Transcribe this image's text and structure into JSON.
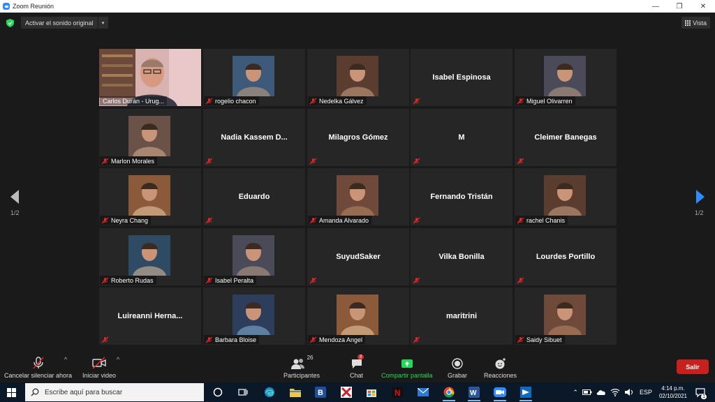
{
  "window": {
    "title": "Zoom Reunión",
    "minimize": "—",
    "restore": "❐",
    "close": "✕"
  },
  "topbar": {
    "original_sound_label": "Activar el sonido original",
    "caret": "▾",
    "view_label": "Vista"
  },
  "pager": {
    "left_page": "1/2",
    "right_page": "1/2"
  },
  "participants": [
    {
      "name": "Carlos Durán - Urug...",
      "type": "video",
      "active": true
    },
    {
      "name": "rogelio chacon",
      "type": "photo"
    },
    {
      "name": "Nedelka Gálvez",
      "type": "photo"
    },
    {
      "name": "Isabel Espinosa",
      "type": "text"
    },
    {
      "name": "Miguel Olivarren",
      "type": "photo"
    },
    {
      "name": "Marlon Morales",
      "type": "photo"
    },
    {
      "name": "Nadia Kassem D...",
      "type": "text"
    },
    {
      "name": "Milagros Gómez",
      "type": "text"
    },
    {
      "name": "M",
      "type": "text"
    },
    {
      "name": "Cleimer Banegas",
      "type": "text"
    },
    {
      "name": "Neyra Chang",
      "type": "photo"
    },
    {
      "name": "Eduardo",
      "type": "text"
    },
    {
      "name": "Amanda Alvarado",
      "type": "photo"
    },
    {
      "name": "Fernando Tristán",
      "type": "text"
    },
    {
      "name": "rachel Chanis",
      "type": "photo"
    },
    {
      "name": "Roberto Rudas",
      "type": "photo"
    },
    {
      "name": "Isabel Peralta",
      "type": "photo"
    },
    {
      "name": "SuyudSaker",
      "type": "text"
    },
    {
      "name": "Vilka Bonilla",
      "type": "text"
    },
    {
      "name": "Lourdes Portillo",
      "type": "text"
    },
    {
      "name": "Luireanni  Herna...",
      "type": "text"
    },
    {
      "name": "Barbara Bloise",
      "type": "photo"
    },
    {
      "name": "Mendoza Angel",
      "type": "photo"
    },
    {
      "name": "maritrini",
      "type": "text"
    },
    {
      "name": "Saidy Sibuet",
      "type": "photo"
    }
  ],
  "toolbar": {
    "mute_label": "Cancelar silenciar ahora",
    "video_label": "Iniciar video",
    "participants_label": "Participantes",
    "participants_count": "26",
    "chat_label": "Chat",
    "chat_badge": "3",
    "share_label": "Compartir pantalla",
    "record_label": "Grabar",
    "reactions_label": "Reacciones",
    "leave_label": "Salir",
    "chevron": "^"
  },
  "taskbar": {
    "search_placeholder": "Escribe aquí para buscar",
    "language": "ESP",
    "time": "4:14 p.m.",
    "date": "02/10/2021",
    "notification_count": "1"
  },
  "colors": {
    "active_speaker": "#cbe02a",
    "leave": "#c8201c",
    "share": "#23d959",
    "mute_red": "#e02828"
  }
}
